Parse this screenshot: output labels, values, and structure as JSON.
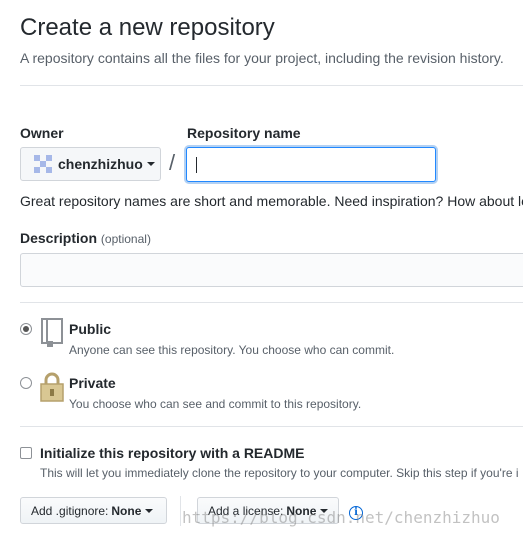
{
  "header": {
    "title": "Create a new repository",
    "subtitle": "A repository contains all the files for your project, including the revision history."
  },
  "owner": {
    "label": "Owner",
    "value": "chenzhizhuo"
  },
  "repo_name": {
    "label": "Repository name",
    "separator": "/",
    "value": ""
  },
  "hint": "Great repository names are short and memorable. Need inspiration? How about le",
  "description": {
    "label": "Description",
    "optional": "(optional)",
    "value": ""
  },
  "visibility": {
    "public": {
      "title": "Public",
      "note": "Anyone can see this repository. You choose who can commit.",
      "selected": true
    },
    "private": {
      "title": "Private",
      "note": "You choose who can see and commit to this repository.",
      "selected": false
    }
  },
  "readme": {
    "title": "Initialize this repository with a README",
    "note": "This will let you immediately clone the repository to your computer. Skip this step if you're i",
    "checked": false
  },
  "gitignore": {
    "key": "Add .gitignore:",
    "value": "None"
  },
  "license": {
    "key": "Add a license:",
    "value": "None"
  },
  "watermark": "https://blog.csdn.net/chenzhizhuo",
  "colors": {
    "accent": "#0366d6",
    "focus": "#2188ff",
    "text": "#24292e",
    "muted": "#586069"
  }
}
